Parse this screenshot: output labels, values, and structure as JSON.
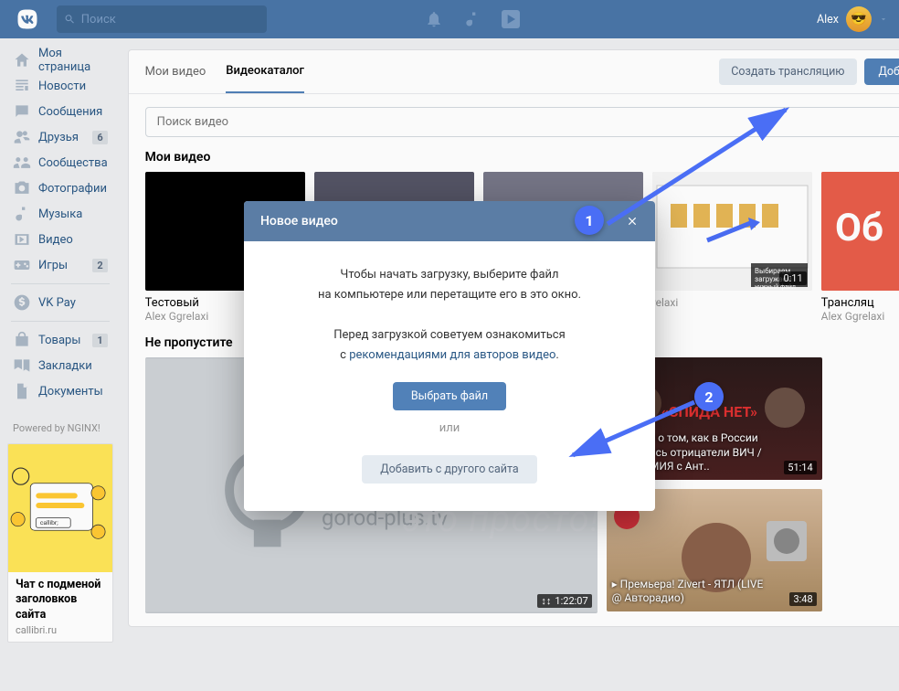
{
  "header": {
    "search_placeholder": "Поиск",
    "user_name": "Alex"
  },
  "sidebar": {
    "items": [
      {
        "icon": "home",
        "label": "Моя страница"
      },
      {
        "icon": "news",
        "label": "Новости"
      },
      {
        "icon": "msg",
        "label": "Сообщения"
      },
      {
        "icon": "friends",
        "label": "Друзья",
        "badge": "6"
      },
      {
        "icon": "groups",
        "label": "Сообщества"
      },
      {
        "icon": "photos",
        "label": "Фотографии"
      },
      {
        "icon": "music",
        "label": "Музыка"
      },
      {
        "icon": "video",
        "label": "Видео"
      },
      {
        "icon": "games",
        "label": "Игры",
        "badge": "2"
      }
    ],
    "items2": [
      {
        "icon": "pay",
        "label": "VK Pay"
      }
    ],
    "items3": [
      {
        "icon": "goods",
        "label": "Товары",
        "badge": "1"
      },
      {
        "icon": "bookmarks",
        "label": "Закладки"
      },
      {
        "icon": "docs",
        "label": "Документы"
      }
    ],
    "powered": "Powered by NGINX!",
    "ad_title": "Чат с подменой заголовков сайта",
    "ad_sub": "callibri.ru"
  },
  "main": {
    "tab1": "Мои видео",
    "tab2": "Видеокаталог",
    "btn_stream": "Создать трансляцию",
    "btn_add": "Добавить видео",
    "video_search_placeholder": "Поиск видео",
    "section1": "Мои видео",
    "section2": "Не пропустите",
    "videos1": [
      {
        "title": "Тестовый",
        "author": "Alex Ggrelaxi",
        "dur": ""
      },
      {
        "title": "",
        "author": "",
        "dur": ""
      },
      {
        "title": "",
        "author": "",
        "dur": ""
      },
      {
        "title": "",
        "author": "relaxi",
        "dur": "0:11"
      },
      {
        "title": "Трансляц",
        "author": "Alex Ggrelaxi",
        "dur": ""
      }
    ],
    "big_dur": "1:22:07",
    "side_videos": [
      {
        "title": "Фильм о том, как в России появились отрицатели ВИЧ / ЭПИДЕМИЯ с Ант..",
        "dur": "51:14"
      },
      {
        "title": "Премьера! Zivert - ЯТЛ (LIVE @ Авторадио)",
        "dur": "3:48"
      }
    ]
  },
  "modal": {
    "title": "Новое видео",
    "line1": "Чтобы начать загрузку, выберите файл",
    "line2": "на компьютере или перетащите его в это окно.",
    "line3": "Перед загрузкой советуем ознакомиться",
    "line4a": "с ",
    "link": "рекомендациями для авторов видео",
    "link_after": ".",
    "btn_select": "Выбрать файл",
    "or": "или",
    "btn_other": "Добавить с другого сайта"
  },
  "annot": {
    "n1": "1",
    "n2": "2"
  }
}
